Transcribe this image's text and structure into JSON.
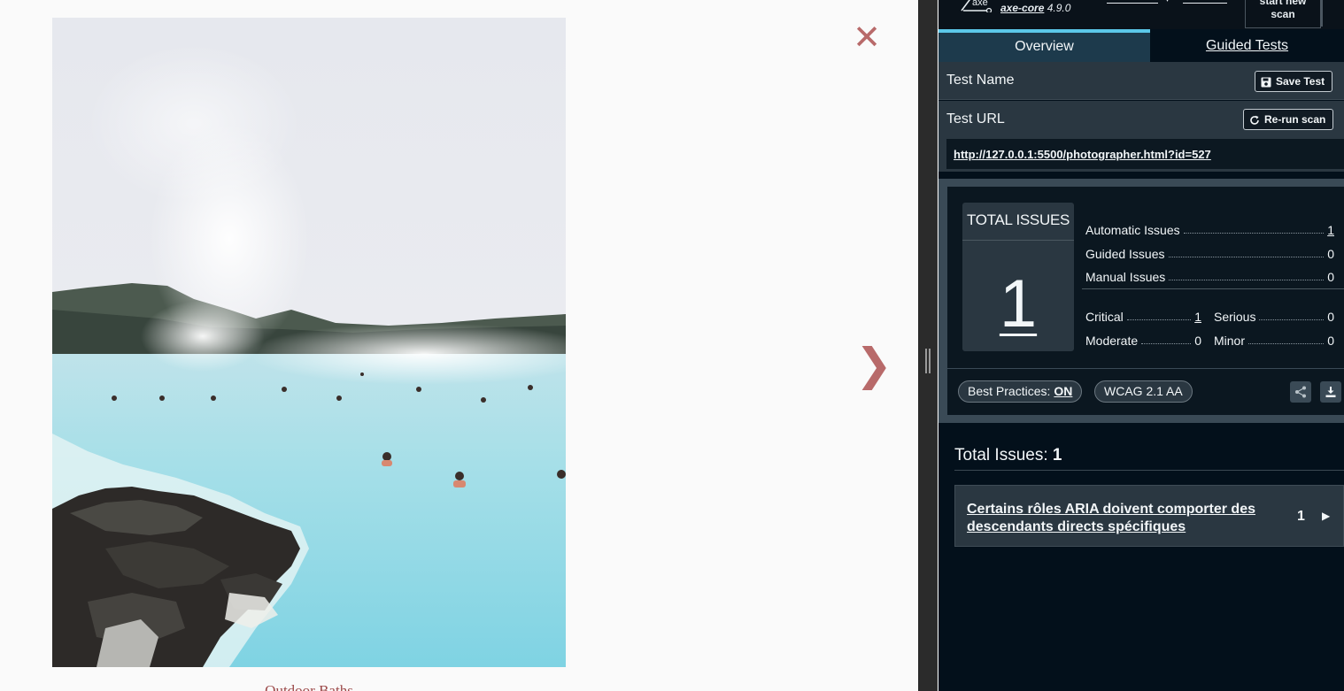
{
  "lightbox": {
    "close_symbol": "✕",
    "next_symbol": "❯",
    "caption": "Outdoor Baths"
  },
  "axe": {
    "logo_text": "axe",
    "product": "axe-core",
    "version": "4.9.0",
    "new_scan_line1": "start new",
    "new_scan_line2": "scan",
    "tabs": {
      "overview": "Overview",
      "guided": "Guided Tests"
    },
    "test_name_label": "Test Name",
    "save_test_label": "Save Test",
    "test_url_label": "Test URL",
    "rerun_label": "Re-run scan",
    "url": "http://127.0.0.1:5500/photographer.html?id=527",
    "summary": {
      "total_title": "TOTAL ISSUES",
      "total_value": "1",
      "automatic_label": "Automatic Issues",
      "automatic_value": "1",
      "guided_label": "Guided Issues",
      "guided_value": "0",
      "manual_label": "Manual Issues",
      "manual_value": "0",
      "critical_label": "Critical",
      "critical_value": "1",
      "serious_label": "Serious",
      "serious_value": "0",
      "moderate_label": "Moderate",
      "moderate_value": "0",
      "minor_label": "Minor",
      "minor_value": "0"
    },
    "best_practices_label": "Best Practices:",
    "best_practices_state": "ON",
    "standard": "WCAG 2.1 AA",
    "issues_heading_label": "Total Issues:",
    "issues_heading_value": "1",
    "issues": [
      {
        "title": "Certains rôles ARIA doivent comporter des descendants directs spécifiques",
        "count": "1"
      }
    ]
  },
  "colors": {
    "panel_bg": "#03101b",
    "accent_tab": "#5bc8e9",
    "lightbox_control": "#b86a6a"
  }
}
